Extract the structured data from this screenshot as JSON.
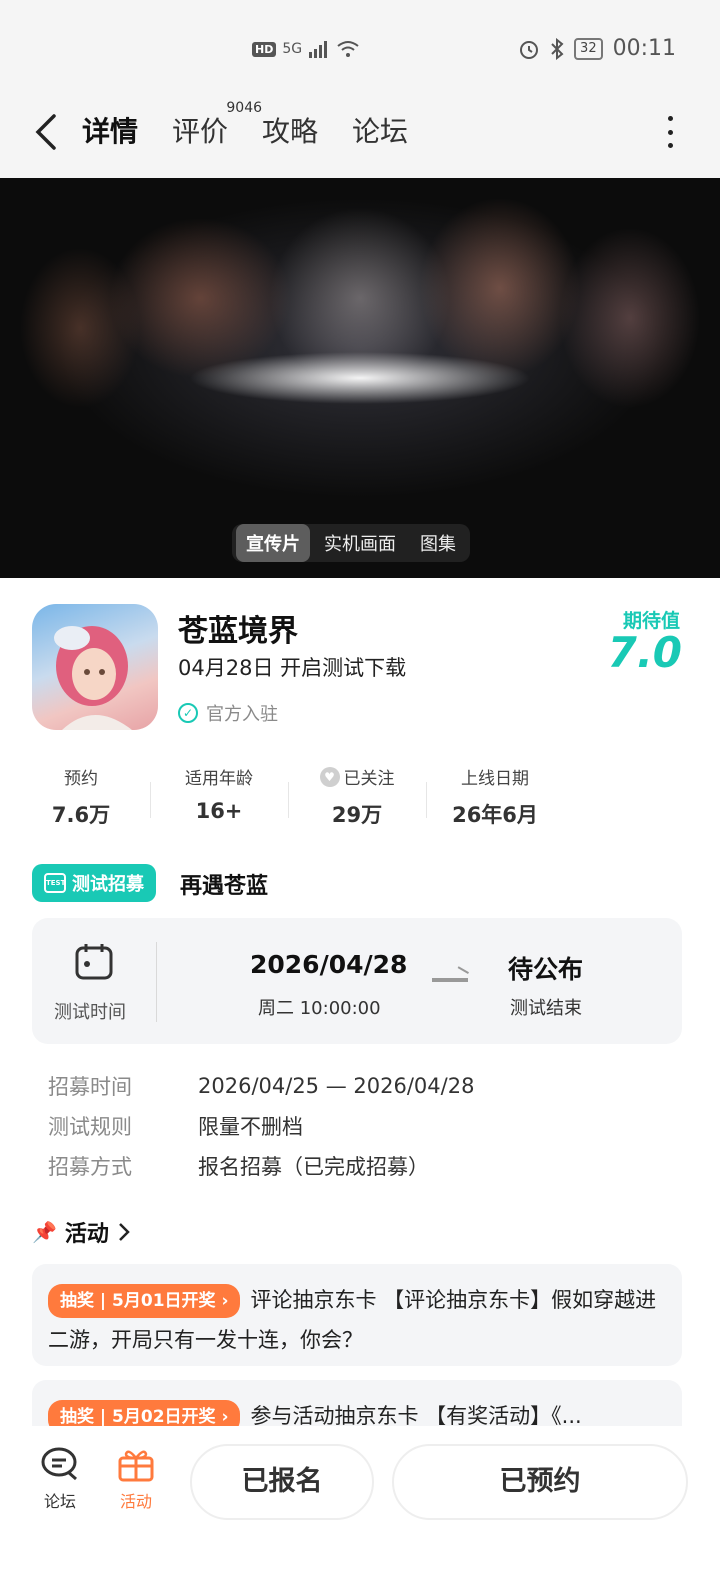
{
  "status_bar": {
    "hd": "HD",
    "network": "5G",
    "battery": "32",
    "time": "00:11"
  },
  "header": {
    "tabs": [
      {
        "label": "详情",
        "active": true
      },
      {
        "label": "评价",
        "badge": "9046"
      },
      {
        "label": "攻略"
      },
      {
        "label": "论坛"
      }
    ]
  },
  "video": {
    "tabs": [
      "宣传片",
      "实机画面",
      "图集"
    ]
  },
  "game": {
    "title": "苍蓝境界",
    "subtitle": "04月28日 开启测试下载",
    "official": "官方入驻",
    "expect_label": "期待值",
    "expect_value": "7.0"
  },
  "stats": [
    {
      "label": "预约",
      "value": "7.6万"
    },
    {
      "label": "适用年龄",
      "value": "16+"
    },
    {
      "label": "已关注",
      "value": "29万"
    },
    {
      "label": "上线日期",
      "value": "26年6月"
    }
  ],
  "recruit": {
    "tag": "测试招募",
    "tag_icon_text": "TEST",
    "title": "再遇苍蓝",
    "time_label": "测试时间",
    "start_date": "2026/04/28",
    "start_sub": "周二  10:00:00",
    "end_main": "待公布",
    "end_sub": "测试结束",
    "rows": [
      {
        "key": "招募时间",
        "value": "2026/04/25 — 2026/04/28"
      },
      {
        "key": "测试规则",
        "value": "限量不删档"
      },
      {
        "key": "招募方式",
        "value": "报名招募（已完成招募）"
      }
    ]
  },
  "activity": {
    "title": "活动",
    "items": [
      {
        "tag": "抽奖 | 5月01日开奖 ›",
        "text": "评论抽京东卡 【评论抽京东卡】假如穿越进二游，开局只有一发十连，你会？"
      },
      {
        "tag": "抽奖 | 5月02日开奖 ›",
        "text": "参与活动抽京东卡 【有奖活动】《..."
      }
    ]
  },
  "bottom_bar": {
    "forum": "论坛",
    "activity": "活动",
    "signed_up": "已报名",
    "reserved": "已预约"
  },
  "colors": {
    "accent": "#19c9b5",
    "orange": "#ff7a3d"
  }
}
